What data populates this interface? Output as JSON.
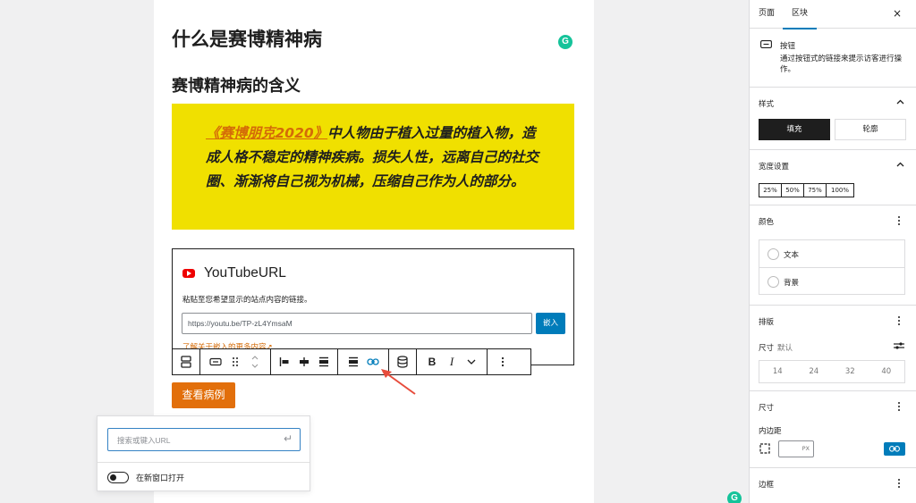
{
  "editor": {
    "heading1": "什么是赛博精神病",
    "heading2": "赛博精神病的含义",
    "quote": {
      "link_text": "《赛博朋克2020》",
      "body_text": "中人物由于植入过量的植入物，造成人格不稳定的精神疾病。损失人性，远离自己的社交圈、渐渐将自己视为机械，压缩自己作为人的部分。"
    },
    "embed": {
      "title": "YouTubeURL",
      "description": "粘贴至您希望显示的站点内容的链接。",
      "url_value": "https://youtu.be/TP-zL4YmsaM",
      "embed_button": "嵌入",
      "learn_more": "了解关于嵌入的更多内容↗"
    },
    "button_label": "查看病例",
    "grammarly": "G"
  },
  "toolbar": {
    "bold": "B",
    "italic": "I"
  },
  "link_popover": {
    "placeholder": "搜索或键入URL",
    "enter_glyph": "↵",
    "new_tab_label": "在新窗口打开"
  },
  "sidebar": {
    "tabs": [
      "页面",
      "区块"
    ],
    "close": "×",
    "block": {
      "name": "按钮",
      "description": "通过按钮式的链接来提示访客进行操作。"
    },
    "styles": {
      "title": "样式",
      "options": [
        "填充",
        "轮廓"
      ]
    },
    "width": {
      "title": "宽度设置",
      "options": [
        "25%",
        "50%",
        "75%",
        "100%"
      ]
    },
    "color": {
      "title": "颜色",
      "items": [
        "文本",
        "背景"
      ]
    },
    "typography": {
      "title": "排版",
      "size_label": "尺寸",
      "size_value": "默认",
      "sizes": [
        "14",
        "24",
        "32",
        "40"
      ]
    },
    "dimensions": {
      "title": "尺寸",
      "padding_label": "内边距",
      "unit": "PX"
    },
    "border": {
      "title": "边框"
    }
  },
  "colors": {
    "accent": "#007cba",
    "quote_bg": "#f0e000",
    "button_bg": "#e26f0b",
    "link": "#d46b08",
    "grammarly": "#15c39a",
    "arrow": "#e74c3c"
  }
}
